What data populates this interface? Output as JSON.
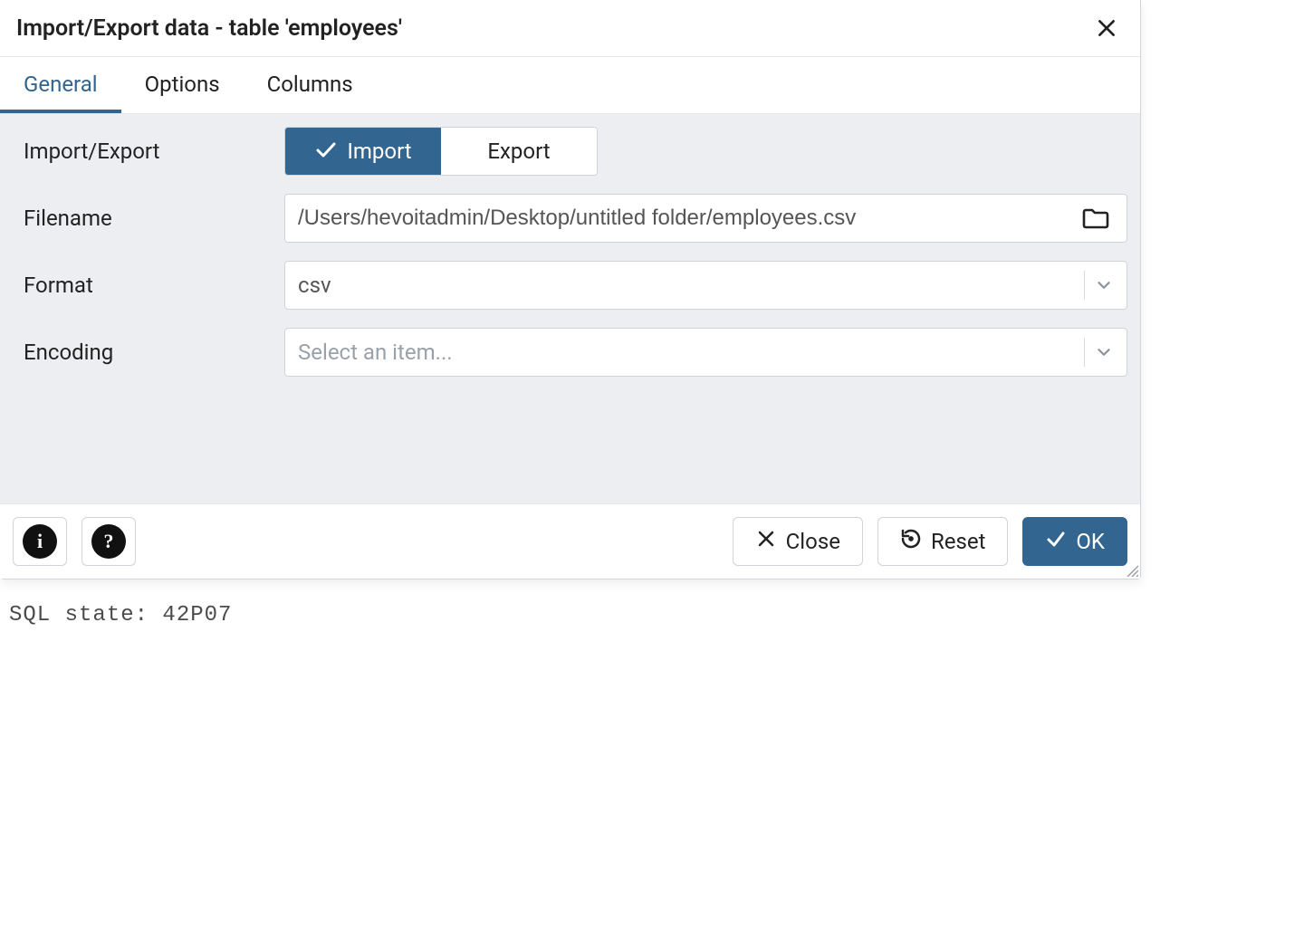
{
  "dialog": {
    "title": "Import/Export data - table 'employees'"
  },
  "tabs": {
    "general": "General",
    "options": "Options",
    "columns": "Columns",
    "active": "general"
  },
  "form": {
    "import_export_label": "Import/Export",
    "toggle": {
      "import": "Import",
      "export": "Export",
      "selected": "import"
    },
    "filename_label": "Filename",
    "filename_value": "/Users/hevoitadmin/Desktop/untitled folder/employees.csv",
    "format_label": "Format",
    "format_value": "csv",
    "encoding_label": "Encoding",
    "encoding_placeholder": "Select an item..."
  },
  "footer": {
    "close": "Close",
    "reset": "Reset",
    "ok": "OK"
  },
  "sql_state_line": "SQL state: 42P07"
}
